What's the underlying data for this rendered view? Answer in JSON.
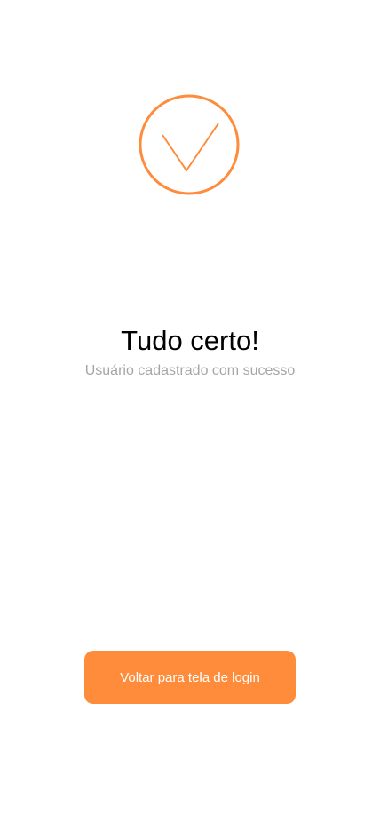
{
  "success": {
    "icon": "checkmark-circle-icon",
    "title": "Tudo certo!",
    "message": "Usuário cadastrado com sucesso"
  },
  "actions": {
    "back_to_login_label": "Voltar para tela de login"
  },
  "colors": {
    "accent": "#ff8c3b",
    "background": "#ffffff",
    "title_text": "#000000",
    "subtitle_text": "#a6a6a6"
  }
}
